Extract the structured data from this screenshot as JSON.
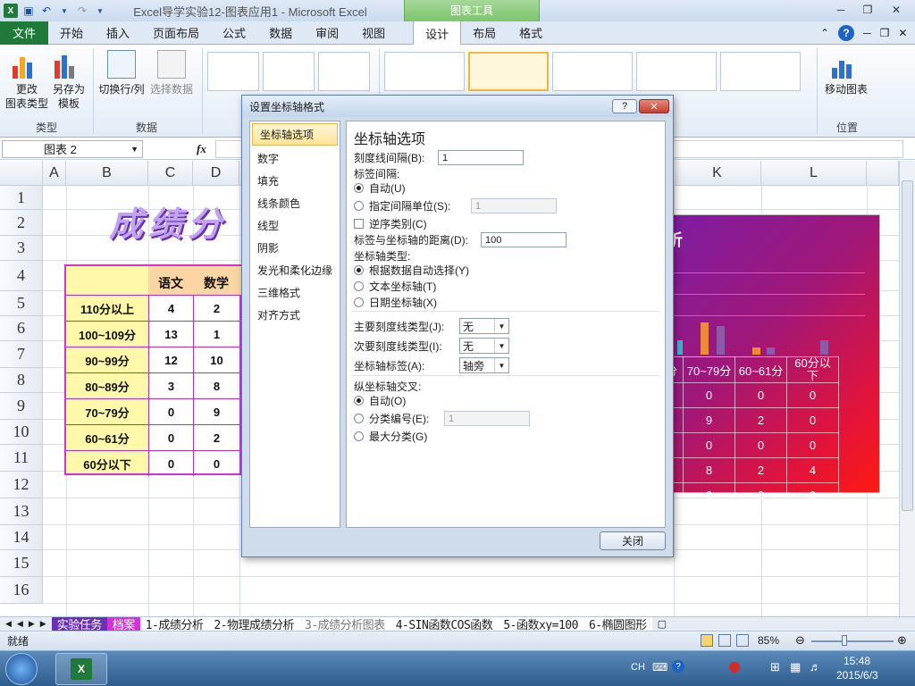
{
  "window": {
    "title": "Excel导学实验12-图表应用1  -  Microsoft Excel",
    "context_tools": "图表工具"
  },
  "tabs": [
    "文件",
    "开始",
    "插入",
    "页面布局",
    "公式",
    "数据",
    "审阅",
    "视图",
    "设计",
    "布局",
    "格式"
  ],
  "ribbon": {
    "change_type": "更改\n图表类型",
    "save_template": "另存为\n模板",
    "switch_rowcol": "切换行/列",
    "select_data": "选择数据",
    "move_chart": "移动图表",
    "group_type": "类型",
    "group_data": "数据",
    "group_location": "位置"
  },
  "formula": {
    "name_box": "图表 2",
    "fx": "fx"
  },
  "columns": [
    "A",
    "B",
    "C",
    "D",
    "K",
    "L"
  ],
  "rows": [
    "1",
    "2",
    "3",
    "4",
    "5",
    "6",
    "7",
    "8",
    "9",
    "10",
    "11",
    "12",
    "13",
    "14",
    "15",
    "16"
  ],
  "sheet": {
    "title_fragment": "成绩分",
    "headers": [
      "语文",
      "数学"
    ],
    "table_rows": [
      {
        "label": "110分以上",
        "c": "4",
        "d": "2"
      },
      {
        "label": "100~109分",
        "c": "13",
        "d": "1"
      },
      {
        "label": "90~99分",
        "c": "12",
        "d": "10"
      },
      {
        "label": "80~89分",
        "c": "3",
        "d": "8"
      },
      {
        "label": "70~79分",
        "c": "0",
        "d": "9"
      },
      {
        "label": "60~61分",
        "c": "0",
        "d": "2"
      },
      {
        "label": "60分以下",
        "c": "0",
        "d": "0"
      }
    ]
  },
  "chart": {
    "title_fragment": "析",
    "col_heads": [
      "分",
      "70~79分",
      "60~61分",
      "60分以\n下"
    ],
    "rows": [
      [
        "0",
        "0",
        "0"
      ],
      [
        "9",
        "2",
        "0"
      ],
      [
        "0",
        "0",
        "0"
      ],
      [
        "8",
        "2",
        "4"
      ],
      [
        "0",
        "0",
        "0"
      ]
    ]
  },
  "dialog": {
    "title": "设置坐标轴格式",
    "nav": [
      "坐标轴选项",
      "数字",
      "填充",
      "线条颜色",
      "线型",
      "阴影",
      "发光和柔化边缘",
      "三维格式",
      "对齐方式"
    ],
    "heading": "坐标轴选项",
    "tick_interval_label": "刻度线间隔(B):",
    "tick_interval_value": "1",
    "label_interval_label": "标签间隔:",
    "auto_label": "自动(U)",
    "spec_unit_label": "指定间隔单位(S):",
    "spec_unit_value": "1",
    "reverse_label": "逆序类别(C)",
    "label_distance_label": "标签与坐标轴的距离(D):",
    "label_distance_value": "100",
    "axis_type_label": "坐标轴类型:",
    "axis_auto": "根据数据自动选择(Y)",
    "axis_text": "文本坐标轴(T)",
    "axis_date": "日期坐标轴(X)",
    "major_tick_label": "主要刻度线类型(J):",
    "major_tick_value": "无",
    "minor_tick_label": "次要刻度线类型(I):",
    "minor_tick_value": "无",
    "axis_label_label": "坐标轴标签(A):",
    "axis_label_value": "轴旁",
    "cross_label": "纵坐标轴交叉:",
    "cross_auto": "自动(O)",
    "cross_cat": "分类编号(E):",
    "cross_cat_value": "1",
    "cross_max": "最大分类(G)",
    "close": "关闭"
  },
  "sheet_tabs": [
    "实验任务",
    "档案",
    "1-成绩分析",
    "2-物理成绩分析",
    "3-成绩分析图表",
    "4-SIN函数COS函数",
    "5-函数xy=100",
    "6-椭圆图形"
  ],
  "status": {
    "ready": "就绪",
    "zoom": "85%"
  },
  "taskbar": {
    "lang": "CH",
    "time": "15:48",
    "date": "2015/6/3"
  }
}
